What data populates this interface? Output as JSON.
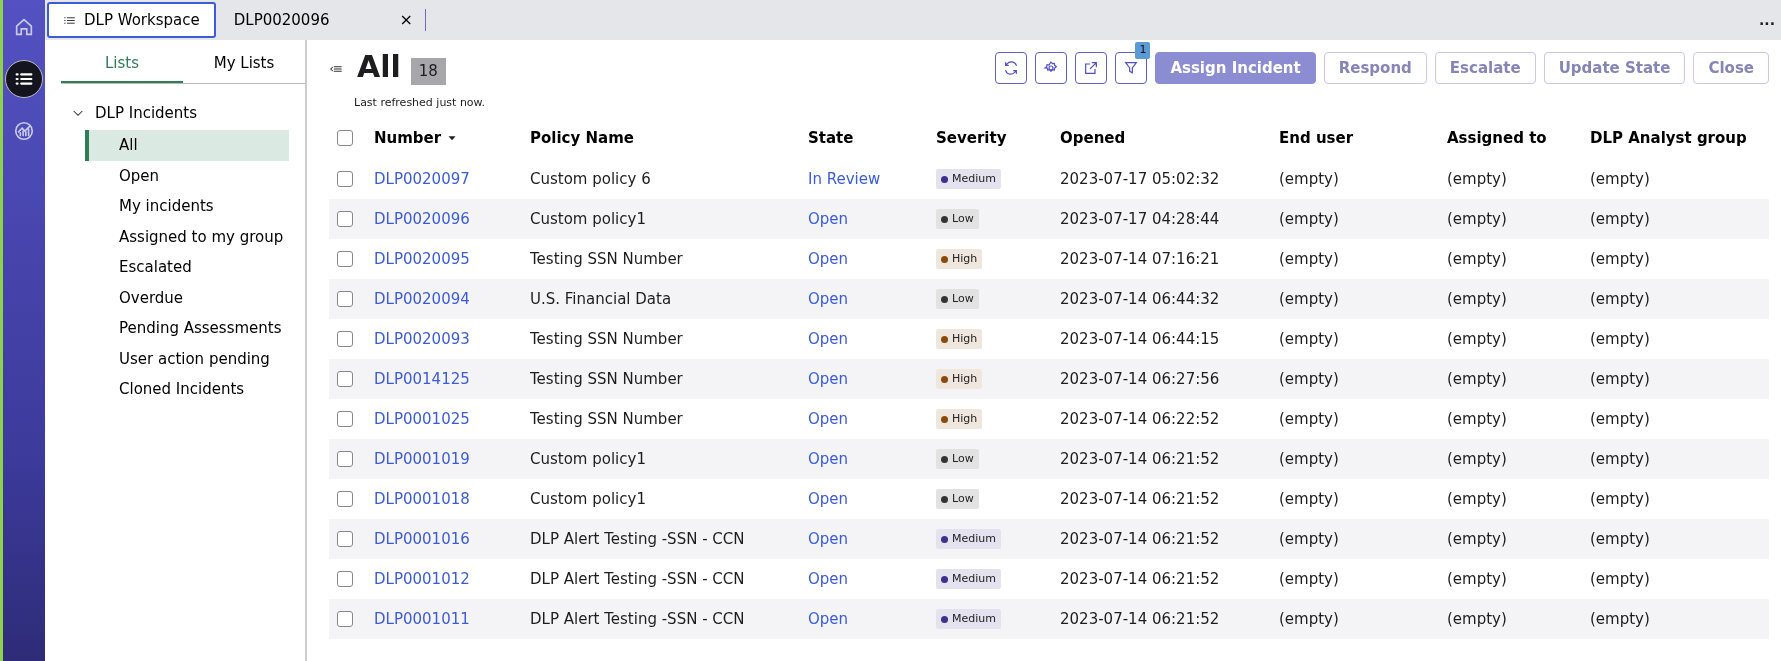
{
  "tabs": [
    {
      "label": "DLP Workspace",
      "selected": true,
      "closable": false
    },
    {
      "label": "DLP0020096",
      "selected": false,
      "closable": true
    }
  ],
  "tab_close": "×",
  "overflow": "...",
  "rail": [
    {
      "kind": "home",
      "selected": false
    },
    {
      "kind": "list",
      "selected": true
    },
    {
      "kind": "chart",
      "selected": false
    }
  ],
  "side_tabs": [
    {
      "label": "Lists",
      "selected": true
    },
    {
      "label": "My Lists",
      "selected": false
    }
  ],
  "tree": [
    {
      "label": "DLP Incidents",
      "expanded": true,
      "children": [
        {
          "label": "All",
          "selected": true
        },
        {
          "label": "Open",
          "selected": false
        },
        {
          "label": "My incidents",
          "selected": false
        },
        {
          "label": "Assigned to my group",
          "selected": false
        },
        {
          "label": "Escalated",
          "selected": false
        },
        {
          "label": "Overdue",
          "selected": false
        },
        {
          "label": "Pending Assessments",
          "selected": false
        },
        {
          "label": "User action pending",
          "selected": false
        },
        {
          "label": "Cloned Incidents",
          "selected": false
        }
      ]
    }
  ],
  "title": "All",
  "count": "18",
  "refreshed": "Last refreshed just now.",
  "filter_badge": "1",
  "actions": [
    {
      "label": "Assign Incident",
      "kind": "primary",
      "disabled": true
    },
    {
      "label": "Respond",
      "kind": "outline",
      "disabled": true
    },
    {
      "label": "Escalate",
      "kind": "outline",
      "disabled": true
    },
    {
      "label": "Update State",
      "kind": "outline",
      "disabled": true
    },
    {
      "label": "Close",
      "kind": "outline",
      "disabled": true
    }
  ],
  "table": {
    "select_all_checked": false,
    "columns": [
      {
        "label": "Number",
        "sorted": true
      },
      {
        "label": "Policy Name",
        "sorted": false
      },
      {
        "label": "State",
        "sorted": false
      },
      {
        "label": "Severity",
        "sorted": false
      },
      {
        "label": "Opened",
        "sorted": false
      },
      {
        "label": "End user",
        "sorted": false
      },
      {
        "label": "Assigned to",
        "sorted": false
      },
      {
        "label": "DLP Analyst group",
        "sorted": false
      }
    ],
    "rows": [
      {
        "checked": false,
        "number": "DLP0020097",
        "policy": "Custom policy 6",
        "state": "In Review",
        "severity": {
          "label": "Medium",
          "color": "#3b2f8f"
        },
        "opened": "2023-07-17 05:02:32",
        "end_user": "(empty)",
        "assigned_to": "(empty)",
        "group": "(empty)"
      },
      {
        "checked": false,
        "number": "DLP0020096",
        "policy": "Custom policy1",
        "state": "Open",
        "severity": {
          "label": "Low",
          "color": "#333333"
        },
        "opened": "2023-07-17 04:28:44",
        "end_user": "(empty)",
        "assigned_to": "(empty)",
        "group": "(empty)"
      },
      {
        "checked": false,
        "number": "DLP0020095",
        "policy": "Testing SSN Number",
        "state": "Open",
        "severity": {
          "label": "High",
          "color": "#8a4a0c"
        },
        "opened": "2023-07-14 07:16:21",
        "end_user": "(empty)",
        "assigned_to": "(empty)",
        "group": "(empty)"
      },
      {
        "checked": false,
        "number": "DLP0020094",
        "policy": "U.S. Financial Data",
        "state": "Open",
        "severity": {
          "label": "Low",
          "color": "#333333"
        },
        "opened": "2023-07-14 06:44:32",
        "end_user": "(empty)",
        "assigned_to": "(empty)",
        "group": "(empty)"
      },
      {
        "checked": false,
        "number": "DLP0020093",
        "policy": "Testing SSN Number",
        "state": "Open",
        "severity": {
          "label": "High",
          "color": "#8a4a0c"
        },
        "opened": "2023-07-14 06:44:15",
        "end_user": "(empty)",
        "assigned_to": "(empty)",
        "group": "(empty)"
      },
      {
        "checked": false,
        "number": "DLP0014125",
        "policy": "Testing SSN Number",
        "state": "Open",
        "severity": {
          "label": "High",
          "color": "#8a4a0c"
        },
        "opened": "2023-07-14 06:27:56",
        "end_user": "(empty)",
        "assigned_to": "(empty)",
        "group": "(empty)"
      },
      {
        "checked": false,
        "number": "DLP0001025",
        "policy": "Testing SSN Number",
        "state": "Open",
        "severity": {
          "label": "High",
          "color": "#8a4a0c"
        },
        "opened": "2023-07-14 06:22:52",
        "end_user": "(empty)",
        "assigned_to": "(empty)",
        "group": "(empty)"
      },
      {
        "checked": false,
        "number": "DLP0001019",
        "policy": "Custom policy1",
        "state": "Open",
        "severity": {
          "label": "Low",
          "color": "#333333"
        },
        "opened": "2023-07-14 06:21:52",
        "end_user": "(empty)",
        "assigned_to": "(empty)",
        "group": "(empty)"
      },
      {
        "checked": false,
        "number": "DLP0001018",
        "policy": "Custom policy1",
        "state": "Open",
        "severity": {
          "label": "Low",
          "color": "#333333"
        },
        "opened": "2023-07-14 06:21:52",
        "end_user": "(empty)",
        "assigned_to": "(empty)",
        "group": "(empty)"
      },
      {
        "checked": false,
        "number": "DLP0001016",
        "policy": "DLP Alert Testing -SSN - CCN",
        "state": "Open",
        "severity": {
          "label": "Medium",
          "color": "#3b2f8f"
        },
        "opened": "2023-07-14 06:21:52",
        "end_user": "(empty)",
        "assigned_to": "(empty)",
        "group": "(empty)"
      },
      {
        "checked": false,
        "number": "DLP0001012",
        "policy": "DLP Alert Testing -SSN - CCN",
        "state": "Open",
        "severity": {
          "label": "Medium",
          "color": "#3b2f8f"
        },
        "opened": "2023-07-14 06:21:52",
        "end_user": "(empty)",
        "assigned_to": "(empty)",
        "group": "(empty)"
      },
      {
        "checked": false,
        "number": "DLP0001011",
        "policy": "DLP Alert Testing -SSN - CCN",
        "state": "Open",
        "severity": {
          "label": "Medium",
          "color": "#3b2f8f"
        },
        "opened": "2023-07-14 06:21:52",
        "end_user": "(empty)",
        "assigned_to": "(empty)",
        "group": "(empty)"
      }
    ]
  }
}
